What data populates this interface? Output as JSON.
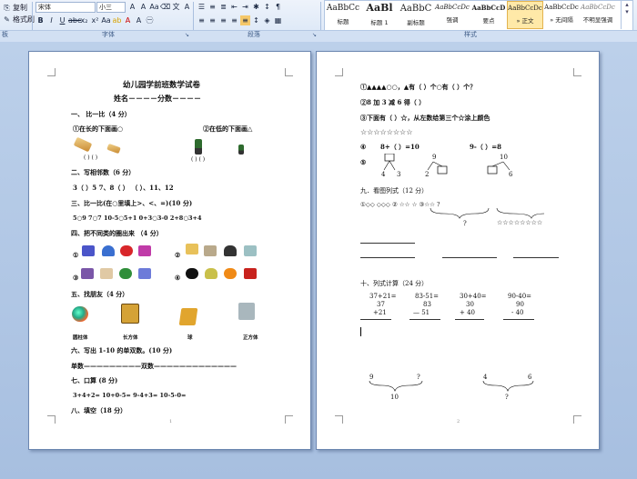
{
  "ribbon": {
    "clipboard_copy": "复制",
    "clipboard_format": "格式刷",
    "font_name": "宋体",
    "font_size": "小三",
    "group_font": "字体",
    "group_paragraph": "段落",
    "group_styles": "样式",
    "group_clipboard": "板"
  },
  "styles": [
    {
      "sample": "AaBbCc",
      "label": "标题"
    },
    {
      "sample": "AaBl",
      "label": "标题 1"
    },
    {
      "sample": "AaBbC",
      "label": "副标题"
    },
    {
      "sample": "AaBbCcDc",
      "label": "强调"
    },
    {
      "sample": "AaBbCcD",
      "label": "要点"
    },
    {
      "sample": "AaBbCcDc",
      "label": "» 正文"
    },
    {
      "sample": "AaBbCcDc",
      "label": "» 无间隔"
    },
    {
      "sample": "AaBbCcDc",
      "label": "不明显强调"
    }
  ],
  "page1": {
    "title": "幼儿园学前班数学试卷",
    "name_score": "姓名－－－－分数－－－－",
    "s1": "一、  比一比（4 分）",
    "s1a": "①在长的下面画○",
    "s1b": "②在低的下面画△",
    "s1_parens": "(     )         (     )",
    "s1_parens2": "(     )            (     )",
    "s2": "二、写相邻数（6 分）",
    "s2_items": "3（ ）5              7、8（ ）           （ ）、11、12",
    "s3": "三、比一比(在○里填上>、<、=)(10 分)",
    "s3_items": "5○9      7○7      10-5○5+1      0+3○3-0      2+8○3+4",
    "s4": "四、把不同类的圈出来 （4 分）",
    "s5": "五、找朋友（4 分）",
    "s5_labels": [
      "圆柱体",
      "长方体",
      "球",
      "正方体"
    ],
    "s6": "六、写出 1-10 的单双数。(10 分)",
    "s6_line": "单数—————————双数—————————————",
    "s7": "七、口算 (8 分)",
    "s7_items": "3+4+2=        10+0-5=        9-4+3=        10-5-0=",
    "s8": "八、填空（18 分）",
    "page_no": "1"
  },
  "page2": {
    "l1": "①▲▲▲▲○○，▲有（   ）个○有（   ）个？",
    "l2": "②8 加 3 减 6 得（   ）",
    "l3": "③下面有（   ）☆，从左数给第三个☆涂上颜色",
    "l4": "☆☆☆☆☆☆☆☆",
    "l5a": "④",
    "l5b": "8+（   ）=10",
    "l5c": "9-（   ）=8",
    "l6": "⑤",
    "tree1_top": "",
    "tree1_left": "4",
    "tree1_right": "3",
    "tree2_top": "9",
    "tree2_left": "2",
    "tree2_right": "",
    "tree3_top": "10",
    "tree3_left": "",
    "tree3_right": "6",
    "s9": "九．看图列式（12 分）",
    "s9_line": "①◇◇      ◇◇◇   ②    ☆☆         ☆    ③☆☆              ?",
    "s9_stars": "☆☆☆☆☆☆☆☆",
    "s9_q": "?",
    "s10": "十、列式计算（24 分）",
    "calc_headers": [
      "37+21=",
      "83-51=",
      "30+40=",
      "90-40="
    ],
    "calc_col1": [
      "37",
      "+21"
    ],
    "calc_col2": [
      "83",
      "—  51"
    ],
    "calc_col3": [
      "30",
      "+ 40"
    ],
    "calc_col4": [
      "90",
      "- 40"
    ],
    "brace1_left": "9",
    "brace1_right": "?",
    "brace1_total": "10",
    "brace2_left": "4",
    "brace2_right": "6",
    "brace2_total": "?",
    "page_no": "2"
  }
}
